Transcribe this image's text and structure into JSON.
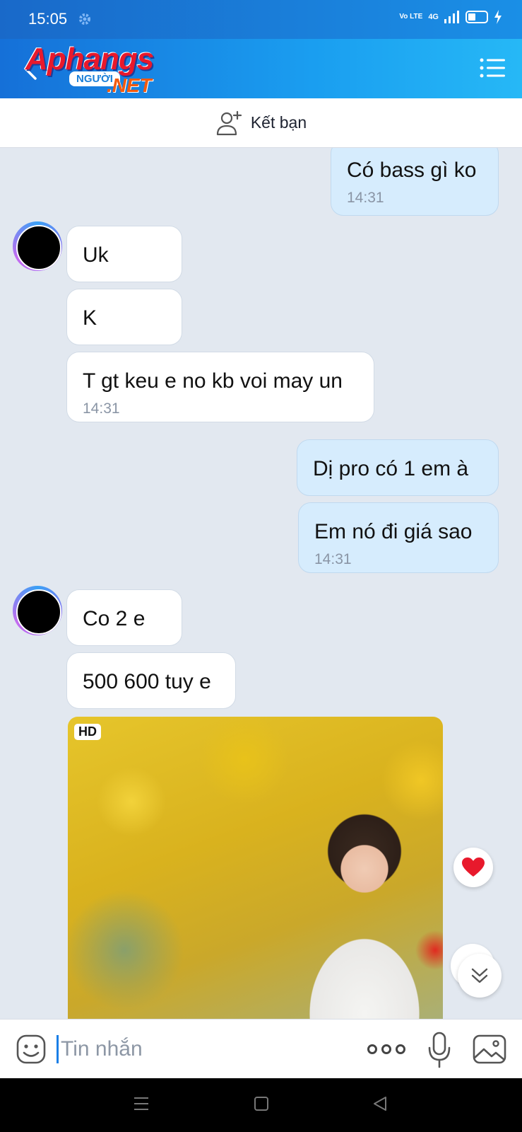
{
  "status_bar": {
    "time": "15:05",
    "network": "4G",
    "volte": "Vo LTE",
    "icons": [
      "gear-icon",
      "signal-icon",
      "battery-icon",
      "charging-icon"
    ]
  },
  "header": {
    "logo_main": "Aphangs",
    "logo_badge": "NGƯỜI",
    "logo_suffix": ".NET",
    "icons": [
      "back-arrow-icon",
      "menu-list-icon"
    ]
  },
  "friend_bar": {
    "label": "Kết bạn",
    "icon": "add-person-icon"
  },
  "messages": [
    {
      "dir": "out",
      "text": "Có bass gì ko",
      "time": "14:31"
    },
    {
      "dir": "in",
      "text": "Uk"
    },
    {
      "dir": "in",
      "text": "K"
    },
    {
      "dir": "in",
      "text": "T gt keu e no kb voi may un",
      "time": "14:31"
    },
    {
      "dir": "out",
      "text": "Dị pro có 1 em à"
    },
    {
      "dir": "out",
      "text": "Em nó đi giá sao",
      "time": "14:31"
    },
    {
      "dir": "in",
      "text": "Co 2 e"
    },
    {
      "dir": "in",
      "text": "500 600 tuy e"
    }
  ],
  "photo": {
    "badge": "HD"
  },
  "input_bar": {
    "placeholder": "Tin nhắn",
    "value": "",
    "icons": [
      "emoji-icon",
      "more-icon",
      "microphone-icon",
      "image-icon"
    ]
  },
  "nav_bar": {
    "icons": [
      "recent-apps-icon",
      "home-icon",
      "back-icon"
    ]
  },
  "colors": {
    "header_start": "#1570d8",
    "header_end": "#26b8f6",
    "bubble_out": "#d6ecfd",
    "bubble_in": "#ffffff",
    "chat_bg": "#e2e8f0",
    "heart": "#e8192c"
  }
}
